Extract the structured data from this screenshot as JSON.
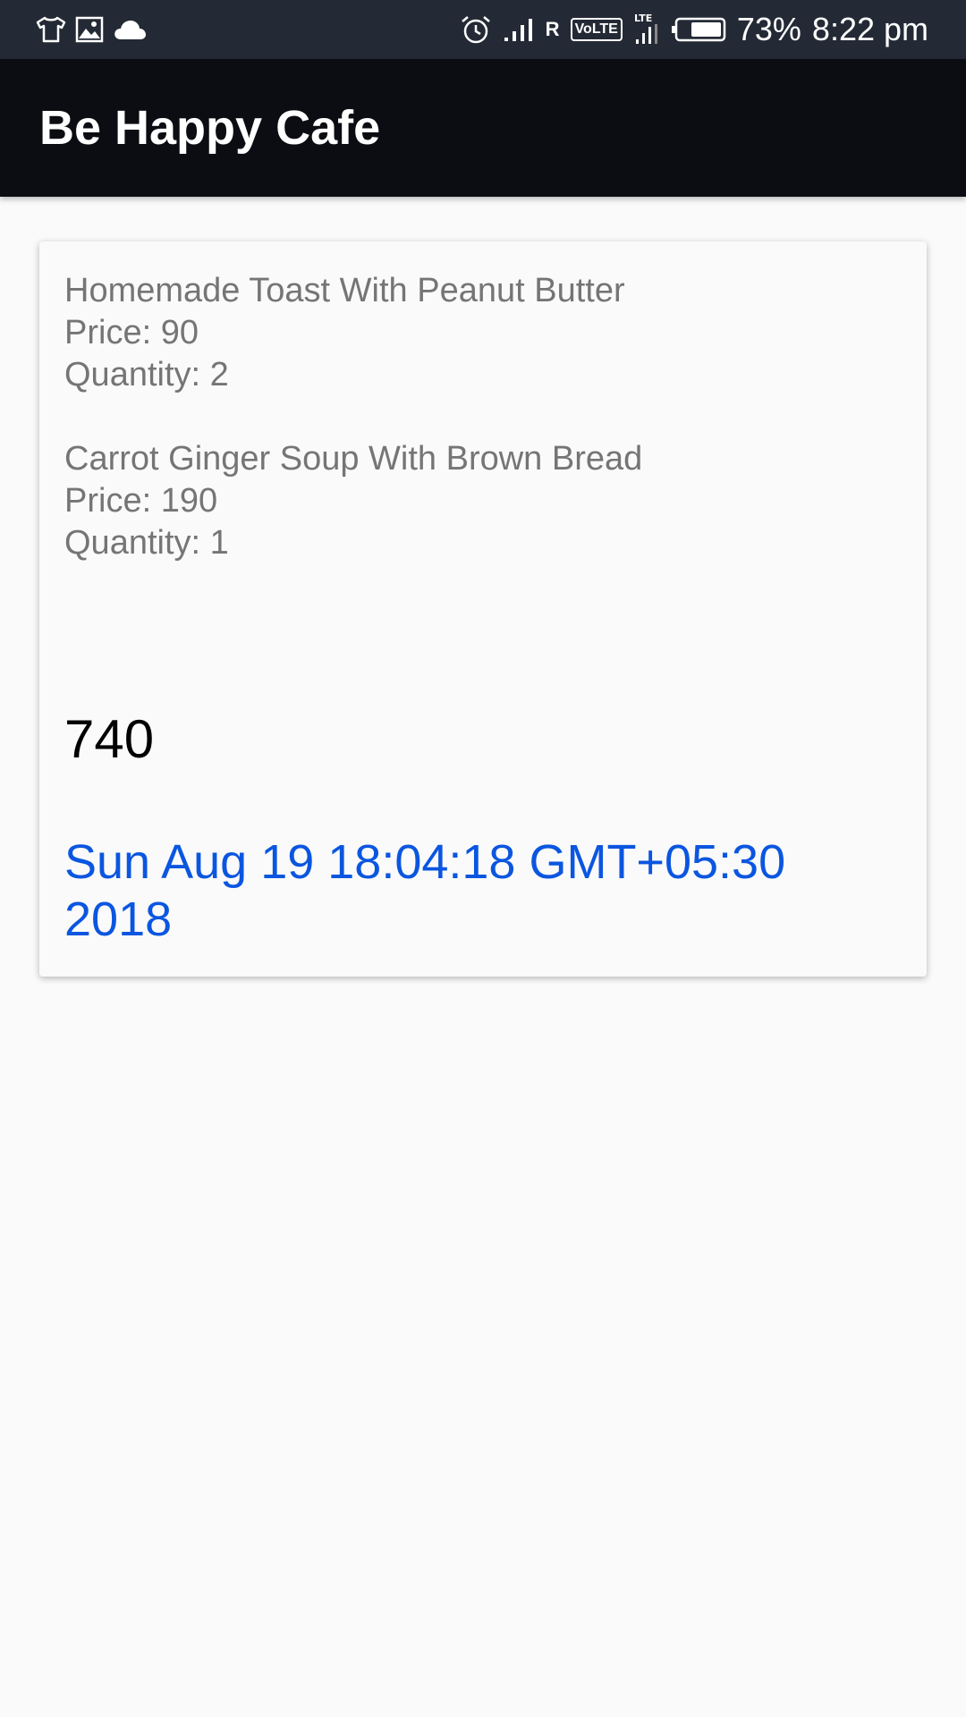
{
  "status_bar": {
    "icons_left": [
      "shirt-icon",
      "image-icon",
      "cloud-icon"
    ],
    "icons_right": [
      "alarm-icon",
      "signal-icon",
      "volte-icon",
      "lte-signal-icon",
      "battery-icon"
    ],
    "roaming": "R",
    "volte": "VoLTE",
    "battery": "73%",
    "time": "8:22 pm"
  },
  "app_bar": {
    "title": "Be Happy Cafe"
  },
  "order": {
    "items": [
      {
        "name": "Homemade Toast With Peanut Butter",
        "price": "Price: 90",
        "quantity": "Quantity: 2"
      },
      {
        "name": "Carrot Ginger Soup With Brown Bread",
        "price": "Price: 190",
        "quantity": "Quantity: 1"
      }
    ],
    "total": "740",
    "date": "Sun Aug 19 18:04:18 GMT+05:30 2018"
  },
  "colors": {
    "status_bar": "#242a35",
    "app_bar": "#0b0d12",
    "item_text": "#757575",
    "date_text": "#0b56e0"
  }
}
